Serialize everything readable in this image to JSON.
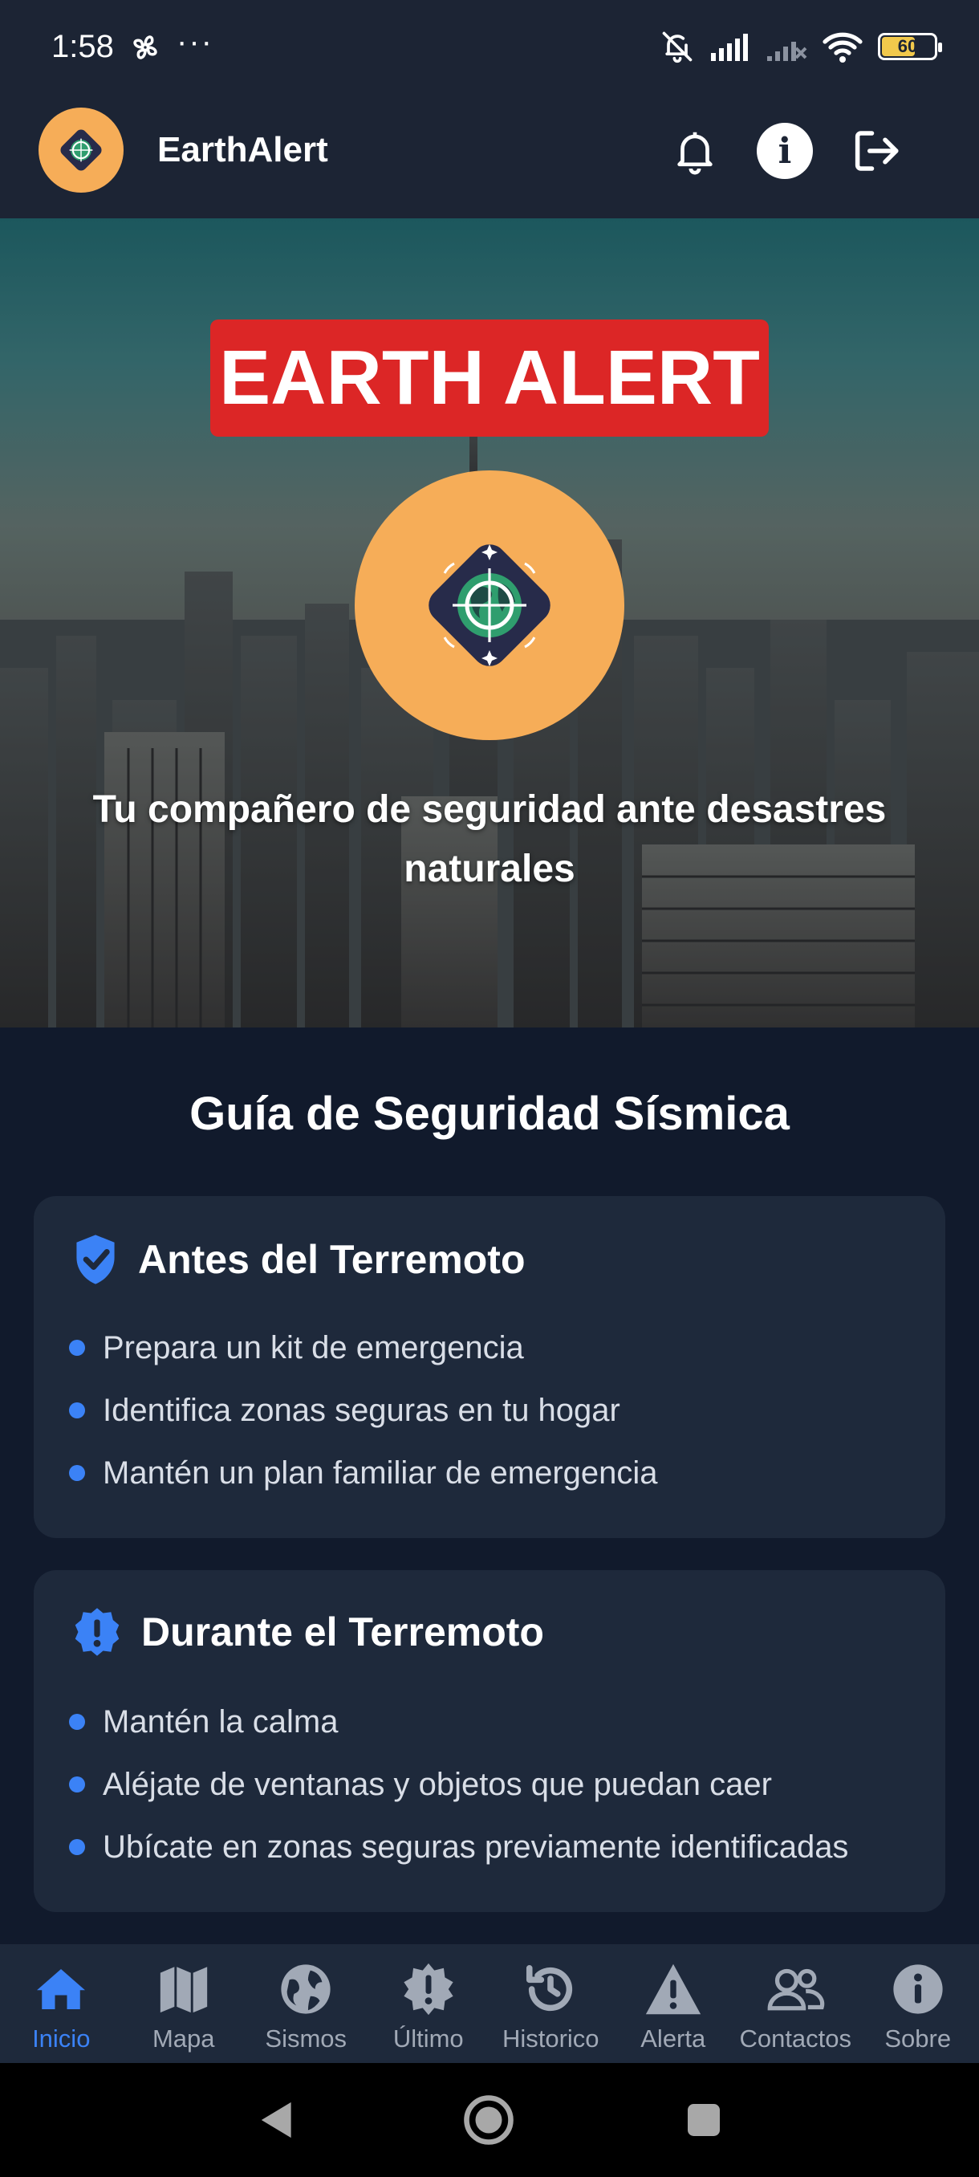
{
  "status_bar": {
    "time": "1:58",
    "overflow": "···",
    "battery_level": "60",
    "icons": [
      "fan-icon",
      "bell-off-icon",
      "signal-icon",
      "signal-off-icon",
      "wifi-icon",
      "battery-icon"
    ]
  },
  "header": {
    "app_name": "EarthAlert",
    "icons": [
      "notification-bell-icon",
      "info-icon",
      "logout-icon"
    ],
    "info_glyph": "i"
  },
  "hero": {
    "badge": "EARTH ALERT",
    "tagline": "Tu compañero de seguridad ante desastres naturales"
  },
  "guide": {
    "title": "Guía de Seguridad Sísmica",
    "cards": [
      {
        "title": "Antes del Terremoto",
        "icon": "shield-check-icon",
        "items": [
          "Prepara un kit de emergencia",
          "Identifica zonas seguras en tu hogar",
          "Mantén un plan familiar de emergencia"
        ]
      },
      {
        "title": "Durante el Terremoto",
        "icon": "alert-badge-icon",
        "items": [
          "Mantén la calma",
          "Aléjate de ventanas y objetos que puedan caer",
          "Ubícate en zonas seguras previamente identificadas"
        ]
      }
    ]
  },
  "bottom_nav": {
    "items": [
      {
        "label": "Inicio",
        "icon": "home-icon",
        "active": true
      },
      {
        "label": "Mapa",
        "icon": "map-icon"
      },
      {
        "label": "Sismos",
        "icon": "globe-icon"
      },
      {
        "label": "Último",
        "icon": "burst-alert-icon"
      },
      {
        "label": "Historico",
        "icon": "history-icon"
      },
      {
        "label": "Alerta",
        "icon": "warning-triangle-icon"
      },
      {
        "label": "Contactos",
        "icon": "contacts-icon"
      },
      {
        "label": "Sobre",
        "icon": "info-icon"
      }
    ]
  },
  "colors": {
    "accent": "#3b82f6",
    "danger": "#dc2626",
    "logo_bg": "#f6ad58",
    "card_bg": "#1e293b",
    "page_bg": "#111a2c"
  }
}
